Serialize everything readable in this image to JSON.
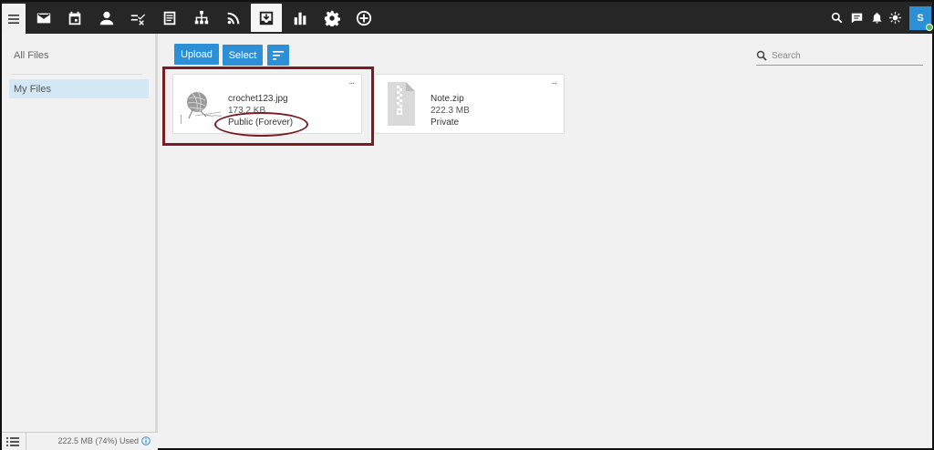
{
  "topbar": {
    "nav_icons": [
      "menu-icon",
      "mail-icon",
      "calendar-icon",
      "contacts-icon",
      "tasks-icon",
      "notes-icon",
      "sitemap-icon",
      "rss-icon",
      "files-icon",
      "reports-icon",
      "settings-icon",
      "add-icon"
    ],
    "active_icon": "files-icon",
    "right_icons": [
      "search-icon",
      "chat-icon",
      "bell-icon",
      "brightness-icon"
    ],
    "avatar_initial": "S",
    "avatar_color": "#2d8fd5",
    "online_color": "#5cb85c"
  },
  "sidebar": {
    "all_files": "All Files",
    "my_files": "My Files",
    "usage": "222.5 MB (74%) Used"
  },
  "toolbar": {
    "upload_label": "Upload",
    "select_label": "Select",
    "accent": "#2d8fd5"
  },
  "search": {
    "placeholder": "Search"
  },
  "files": [
    {
      "name": "crochet123.jpg",
      "size": "173.2 KB",
      "sharing": "Public (Forever)",
      "more": "..."
    },
    {
      "name": "Note.zip",
      "size": "222.3 MB",
      "sharing": "Private",
      "more": "..."
    }
  ],
  "annotation_color": "#7a1c24"
}
